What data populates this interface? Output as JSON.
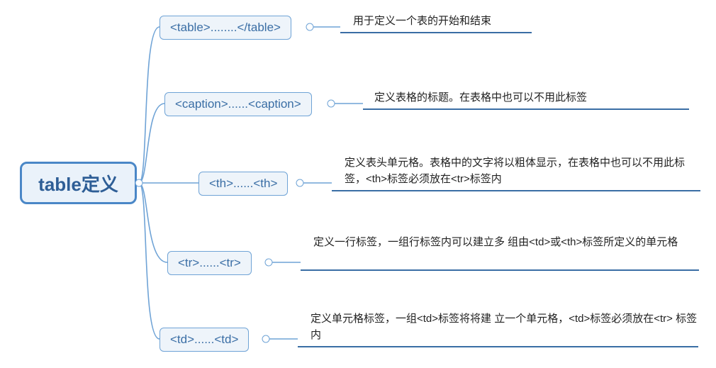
{
  "root": {
    "label": "table定义"
  },
  "nodes": [
    {
      "tag": "<table>........</table>",
      "desc": "用于定义一个表的开始和结束"
    },
    {
      "tag": "<caption>......<caption>",
      "desc": "定义表格的标题。在表格中也可以不用此标签"
    },
    {
      "tag": "<th>......<th>",
      "desc": "定义表头单元格。表格中的文字将以粗体显示，在表格中也可以不用此标签，<th>标签必须放在<tr>标签内"
    },
    {
      "tag": "<tr>......<tr>",
      "desc": "定义一行标签，一组行标签内可以建立多 组由<td>或<th>标签所定义的单元格"
    },
    {
      "tag": "<td>......<td>",
      "desc": "定义单元格标签，一组<td>标签将将建 立一个单元格，<td>标签必须放在<tr> 标签内"
    }
  ]
}
